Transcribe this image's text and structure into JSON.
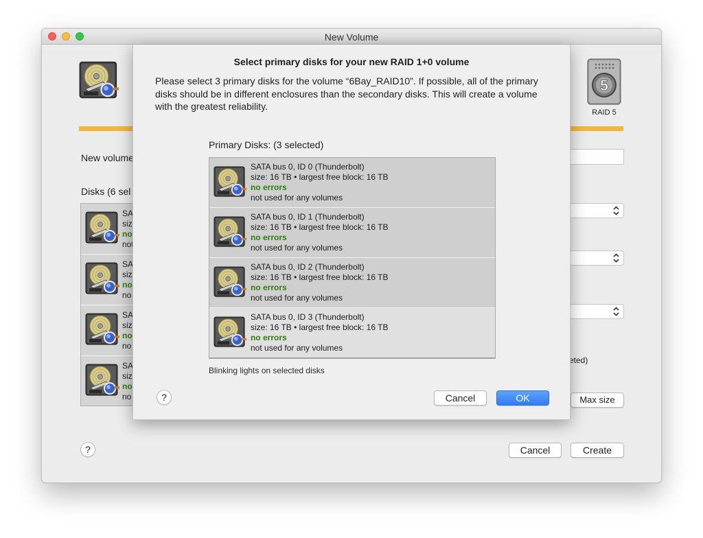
{
  "window": {
    "title": "New Volume",
    "raid_label": "RAID 5",
    "volume_label": "New volume",
    "disks_label": "Disks (6 sel",
    "deleted_text": "eted)",
    "max_size_label": "Max size",
    "cancel_label": "Cancel",
    "create_label": "Create",
    "help_label": "?",
    "bg_disks": [
      {
        "l1": "SATA",
        "l2": "size",
        "l3": "no",
        "l4": "not"
      },
      {
        "l1": "SA",
        "l2": "siz",
        "l3": "no",
        "l4": "no"
      },
      {
        "l1": "SA",
        "l2": "siz",
        "l3": "no",
        "l4": "no"
      },
      {
        "l1": "SA",
        "l2": "siz",
        "l3": "no",
        "l4": "no"
      }
    ]
  },
  "sheet": {
    "title": "Select primary disks for your new RAID 1+0 volume",
    "description": "Please select 3 primary disks for the volume “6Bay_RAID10”.  If possible, all of the primary disks should be in different enclosures than the secondary disks.  This will create a volume with the greatest reliability.",
    "list_label": "Primary Disks: (3 selected)",
    "disks": [
      {
        "name": "SATA bus 0, ID 0 (Thunderbolt)",
        "size": "size: 16 TB • largest free block: 16 TB",
        "status": "no errors",
        "usage": "not used for any volumes",
        "selected": true
      },
      {
        "name": "SATA bus 0, ID 1 (Thunderbolt)",
        "size": "size: 16 TB • largest free block: 16 TB",
        "status": "no errors",
        "usage": "not used for any volumes",
        "selected": true
      },
      {
        "name": "SATA bus 0, ID 2 (Thunderbolt)",
        "size": "size: 16 TB • largest free block: 16 TB",
        "status": "no errors",
        "usage": "not used for any volumes",
        "selected": true
      },
      {
        "name": "SATA bus 0, ID 3 (Thunderbolt)",
        "size": "size: 16 TB • largest free block: 16 TB",
        "status": "no errors",
        "usage": "not used for any volumes",
        "selected": false
      }
    ],
    "blink_text": "Blinking lights on selected disks",
    "help_label": "?",
    "cancel_label": "Cancel",
    "ok_label": "OK"
  },
  "icons": {
    "disk": "hard-drive-icon",
    "raid": "raid-5-enclosure-icon",
    "stepper": "up-down-chevron-icon"
  },
  "colors": {
    "accent_bar": "#f4b73d",
    "ok_button": "#2f7df6",
    "status_ok": "#2a7f0a"
  }
}
